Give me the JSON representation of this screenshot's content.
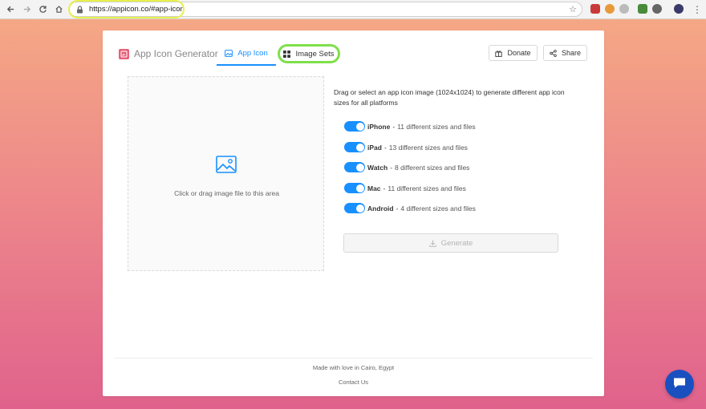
{
  "browser": {
    "url": "https://appicon.co/#app-icon"
  },
  "header": {
    "brand": "App Icon Generator",
    "tabs": [
      {
        "label": "App Icon",
        "active": true
      },
      {
        "label": "Image Sets",
        "active": false
      }
    ],
    "donate_label": "Donate",
    "share_label": "Share"
  },
  "dropzone": {
    "text": "Click or drag image file to this area"
  },
  "main": {
    "description": "Drag or select an app icon image (1024x1024) to generate different app icon sizes for all platforms",
    "options": [
      {
        "name": "iPhone",
        "desc": "11 different sizes and files",
        "enabled": true
      },
      {
        "name": "iPad",
        "desc": "13 different sizes and files",
        "enabled": true
      },
      {
        "name": "Watch",
        "desc": "8 different sizes and files",
        "enabled": true
      },
      {
        "name": "Mac",
        "desc": "11 different sizes and files",
        "enabled": true
      },
      {
        "name": "Android",
        "desc": "4 different sizes and files",
        "enabled": true
      }
    ],
    "separator": "-",
    "generate_label": "Generate"
  },
  "footer": {
    "made_with": "Made with love in Cairo, Egypt",
    "contact": "Contact Us"
  },
  "colors": {
    "accent": "#1890ff",
    "brand": "#e7607a",
    "url_highlight": "#e8f04a",
    "tab_highlight": "#7ee04a",
    "chat": "#1a4fbf"
  }
}
